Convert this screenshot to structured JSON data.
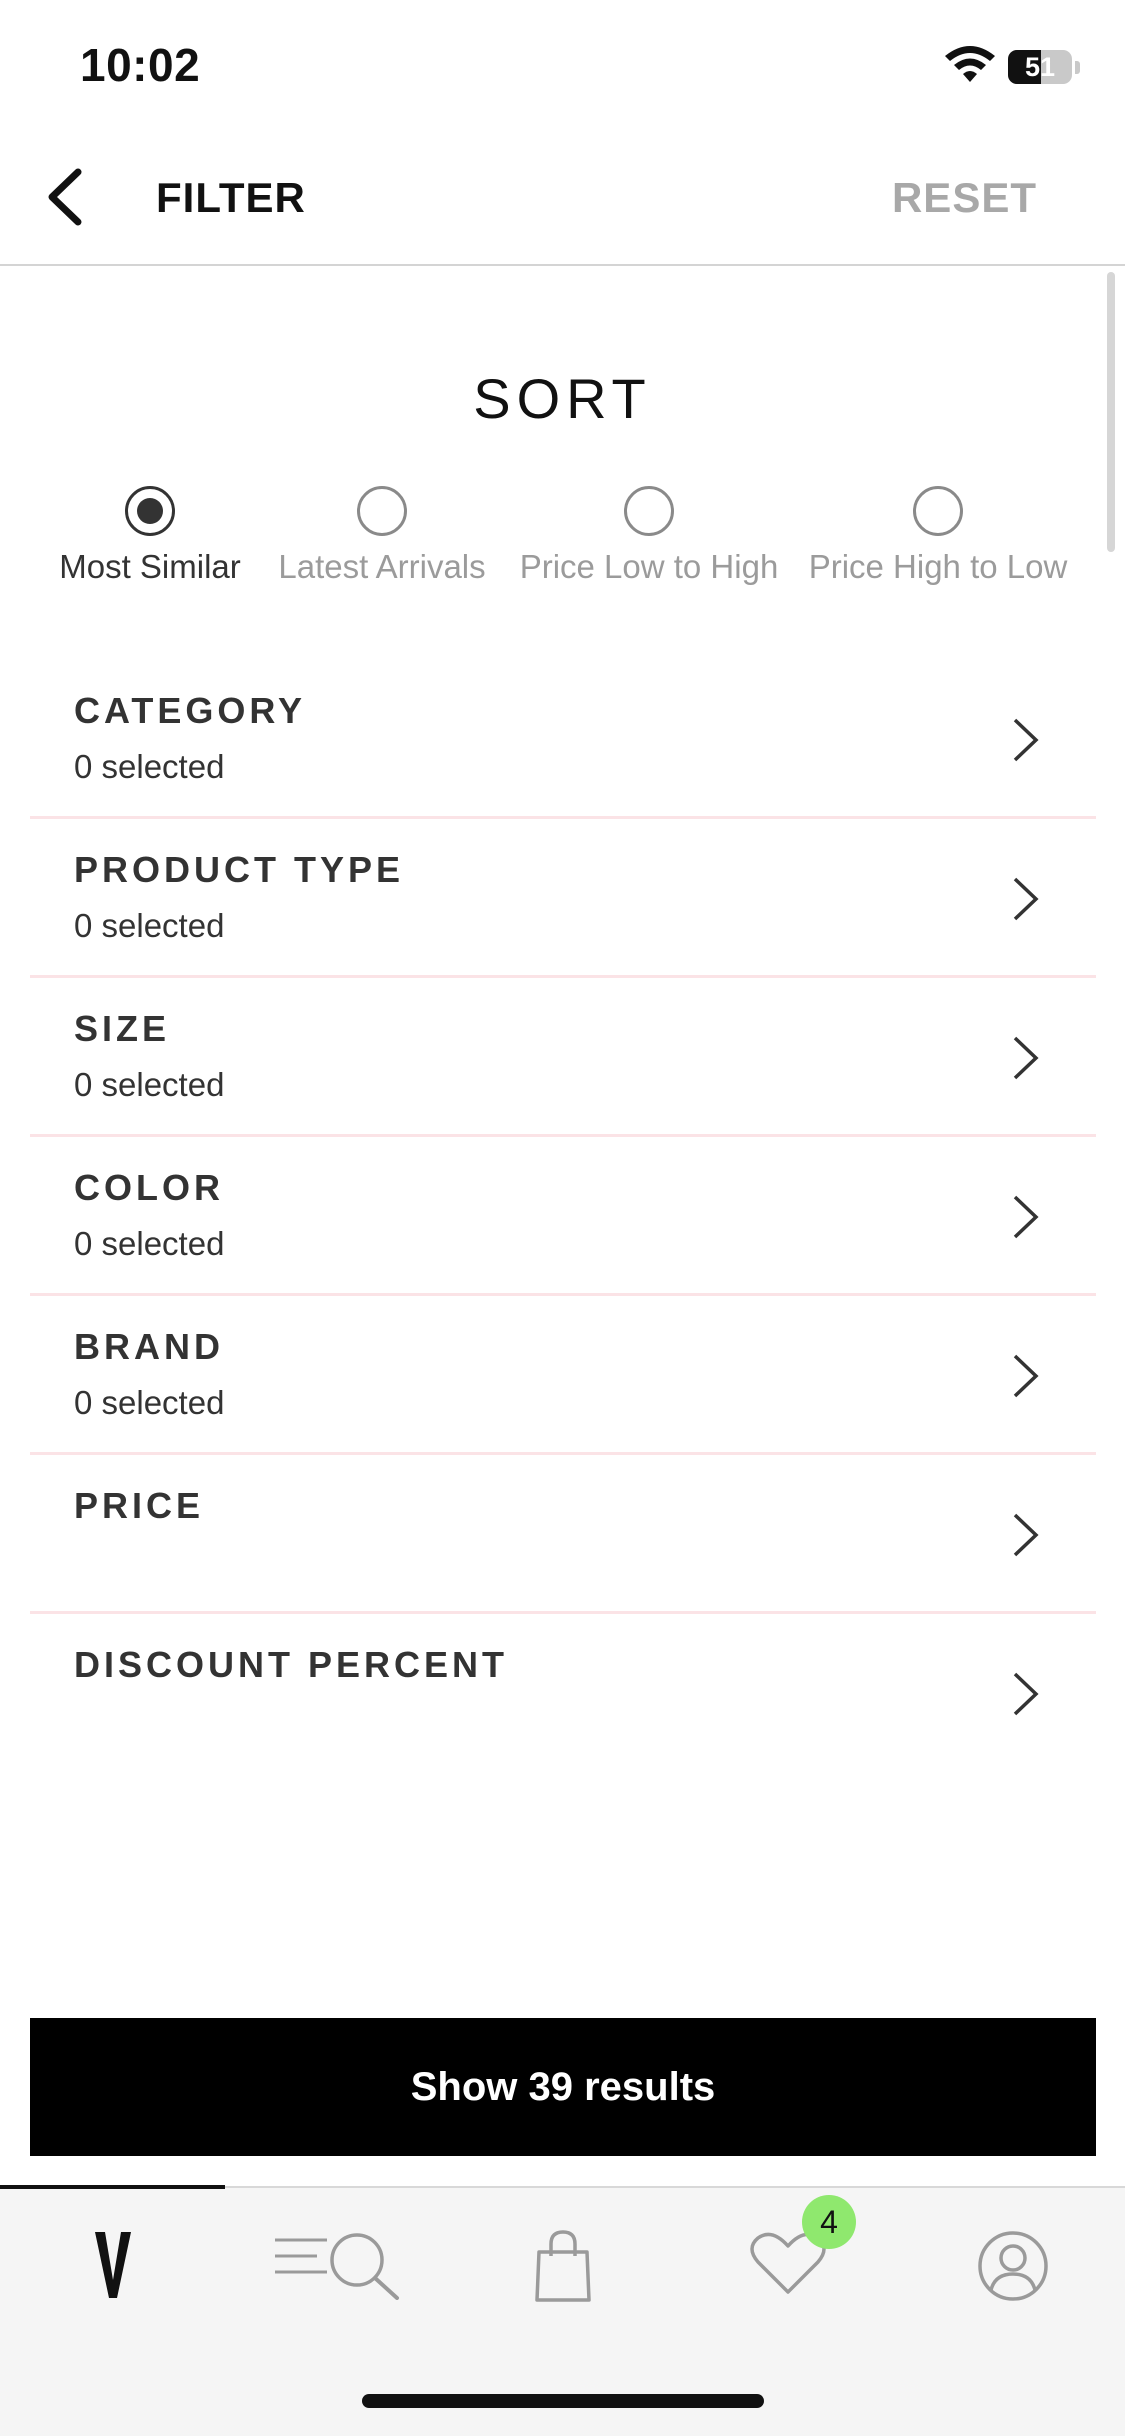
{
  "status_bar": {
    "time": "10:02",
    "battery": "51",
    "battery_level_percent": 51
  },
  "header": {
    "title": "FILTER",
    "reset_label": "RESET",
    "back_icon": "chevron-left-icon"
  },
  "sort": {
    "title": "SORT",
    "options": [
      {
        "label": "Most Similar",
        "selected": true
      },
      {
        "label": "Latest Arrivals",
        "selected": false
      },
      {
        "label": "Price Low to High",
        "selected": false
      },
      {
        "label": "Price High to Low",
        "selected": false
      }
    ]
  },
  "filters": [
    {
      "name": "CATEGORY",
      "status": "0 selected"
    },
    {
      "name": "PRODUCT TYPE",
      "status": "0 selected"
    },
    {
      "name": "SIZE",
      "status": "0 selected"
    },
    {
      "name": "COLOR",
      "status": "0 selected"
    },
    {
      "name": "BRAND",
      "status": "0 selected"
    },
    {
      "name": "PRICE",
      "status": ""
    },
    {
      "name": "DISCOUNT PERCENT",
      "status": ""
    }
  ],
  "show_results_label": "Show 39 results",
  "tab_bar": {
    "tabs": [
      {
        "icon": "logo-v-icon",
        "active": true
      },
      {
        "icon": "menu-search-icon",
        "active": false
      },
      {
        "icon": "shopping-bag-icon",
        "active": false
      },
      {
        "icon": "heart-icon",
        "active": false
      },
      {
        "icon": "profile-icon",
        "active": false
      }
    ],
    "wishlist_badge": "4",
    "badge_color": "#8fe86e"
  }
}
